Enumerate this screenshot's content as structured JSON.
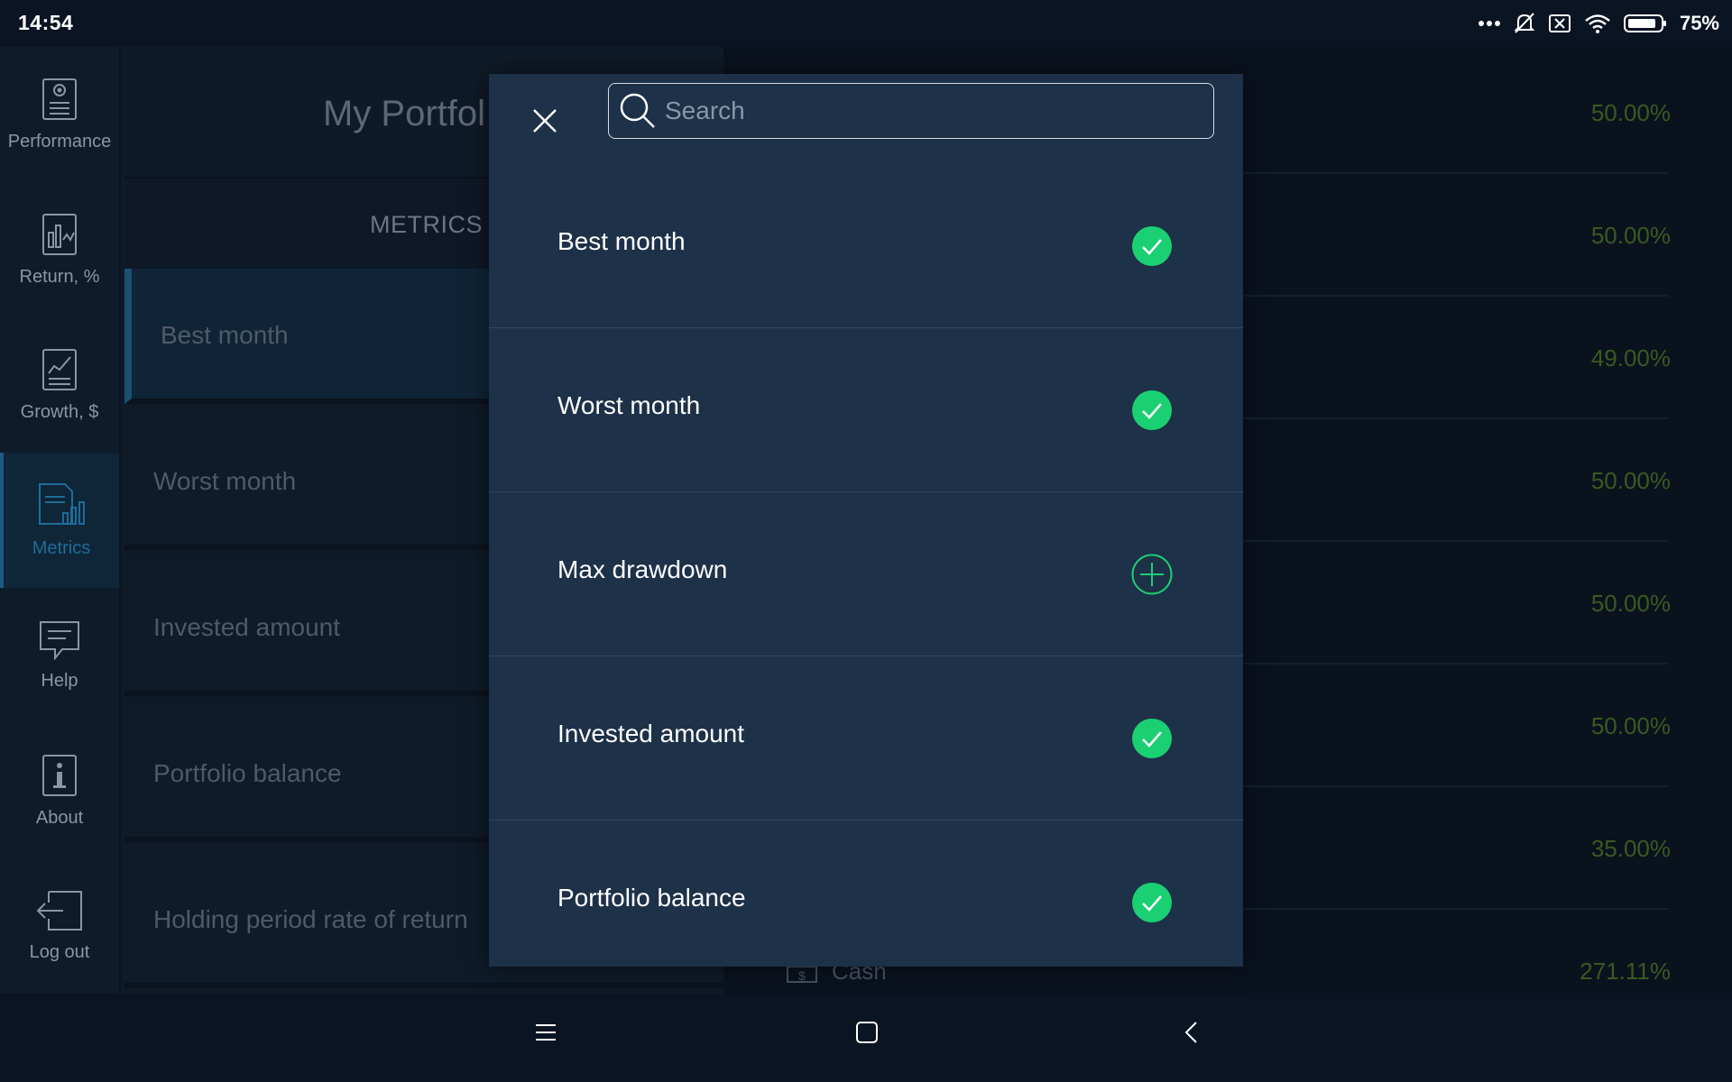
{
  "status_bar": {
    "time": "14:54",
    "battery": "75%"
  },
  "nav": {
    "items": [
      {
        "label": "Performance",
        "icon": "performance-icon"
      },
      {
        "label": "Return, %",
        "icon": "return-chart-icon"
      },
      {
        "label": "Growth, $",
        "icon": "growth-chart-icon"
      },
      {
        "label": "Metrics",
        "icon": "metrics-icon"
      },
      {
        "label": "Help",
        "icon": "help-icon"
      },
      {
        "label": "About",
        "icon": "about-icon"
      },
      {
        "label": "Log out",
        "icon": "logout-icon"
      }
    ],
    "active": "Metrics"
  },
  "background": {
    "title": "My Portfol",
    "metrics_header": "METRICS",
    "rows": [
      "Best month",
      "Worst month",
      "Invested amount",
      "Portfolio balance",
      "Holding period rate of return"
    ],
    "values": [
      "50.00%",
      "50.00%",
      "49.00%",
      "50.00%",
      "50.00%",
      "50.00%",
      "35.00%",
      "271.11%"
    ],
    "cash_label": "Cash"
  },
  "modal": {
    "search_placeholder": "Search",
    "search_value": "",
    "options": [
      {
        "label": "Best month",
        "selected": true
      },
      {
        "label": "Worst month",
        "selected": true
      },
      {
        "label": "Max drawdown",
        "selected": false
      },
      {
        "label": "Invested amount",
        "selected": true
      },
      {
        "label": "Portfolio balance",
        "selected": true
      }
    ]
  },
  "colors": {
    "modal_bg": "#1d3148",
    "check_green": "#1bcf73",
    "value_green": "#3a5a1f",
    "active_blue": "#1e6d99"
  }
}
